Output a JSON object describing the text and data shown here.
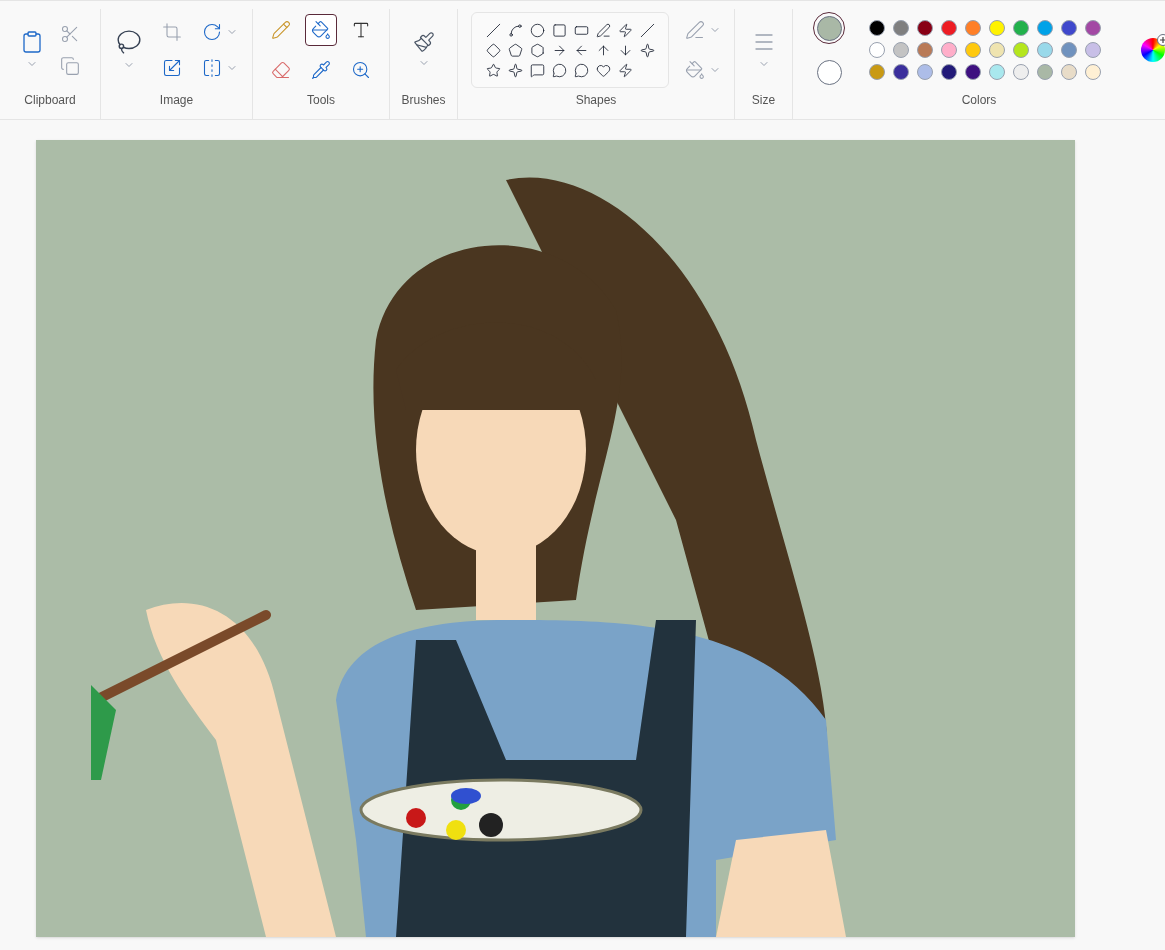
{
  "ribbon": {
    "groups": [
      {
        "kind": "clipboard",
        "label": "Clipboard"
      },
      {
        "label": "Image"
      },
      {
        "kind": "tools",
        "label": "Tools"
      },
      {
        "kind": "brushes",
        "label": "Brushes"
      },
      {
        "kind": "shapes",
        "label": "Shapes"
      },
      {
        "kind": "size",
        "label": "Size"
      },
      {
        "kind": "colors",
        "label": "Colors"
      }
    ]
  },
  "tools": [
    {
      "selected": false
    },
    {
      "selected": true
    },
    {
      "selected": false
    },
    {
      "selected": false
    },
    {
      "selected": false
    },
    {
      "selected": false
    }
  ],
  "active_colors": [
    {
      "color": "#a9b8a6",
      "selected": true
    },
    {
      "color": "#ffffff",
      "selected": false
    }
  ],
  "palette": [
    {
      "color": "#000000"
    },
    {
      "color": "#7f7f7f"
    },
    {
      "color": "#880015"
    },
    {
      "color": "#ed1c24"
    },
    {
      "color": "#ff7f27"
    },
    {
      "color": "#fff200"
    },
    {
      "color": "#22b14c"
    },
    {
      "color": "#00a2e8"
    },
    {
      "color": "#3f48cc"
    },
    {
      "color": "#a349a4"
    },
    {
      "color": "#ffffff"
    },
    {
      "color": "#c3c3c3"
    },
    {
      "color": "#b97a57"
    },
    {
      "color": "#ffaec9"
    },
    {
      "color": "#ffc90e"
    },
    {
      "color": "#efe4b0"
    },
    {
      "color": "#b5e61d"
    },
    {
      "color": "#99d9ea"
    },
    {
      "color": "#7092be"
    },
    {
      "color": "#c8bfe7"
    },
    {
      "color": "#c99a14"
    },
    {
      "color": "#3b2f9c"
    },
    {
      "color": "#adbde8"
    },
    {
      "color": "#221a78"
    },
    {
      "color": "#3e1080"
    },
    {
      "color": "#a9e8ee"
    },
    {
      "color": "#eeeeee"
    },
    {
      "color": "#a9b8a6"
    },
    {
      "color": "#e8dcc8"
    },
    {
      "color": "#fff0d4"
    }
  ]
}
